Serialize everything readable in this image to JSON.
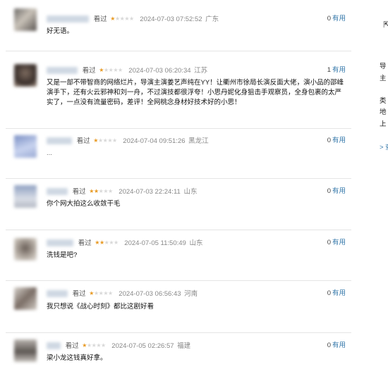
{
  "reviews": [
    {
      "watched": "看过",
      "stars": 1,
      "time": "2024-07-03 07:52:52",
      "loc": "广东",
      "useful_count": "0",
      "useful_label": "有用",
      "content": "好无语。"
    },
    {
      "watched": "看过",
      "stars": 1,
      "time": "2024-07-03 06:20:34",
      "loc": "江苏",
      "useful_count": "1",
      "useful_label": "有用",
      "content": "又是一部不带智商的网络烂片，导演主演姜艺声纯在YY！让衢州市徐局长演反面大佬，演小品的邵峰演手下，还有火云邪神和刘一舟，不过演技都很浮夸！小思丹妮化身狙击手观察员，全身包裹的太严实了，一点没有流量密码，差评！全网桃念身材好技术好的小思！"
    },
    {
      "watched": "看过",
      "stars": 1,
      "time": "2024-07-04 09:51:26",
      "loc": "黑龙江",
      "useful_count": "0",
      "useful_label": "有用",
      "content": "..."
    },
    {
      "watched": "看过",
      "stars": 2,
      "time": "2024-07-03 22:24:11",
      "loc": "山东",
      "useful_count": "0",
      "useful_label": "有用",
      "content": "你个网大拍这么收敛干毛"
    },
    {
      "watched": "看过",
      "stars": 2,
      "time": "2024-07-05 11:50:49",
      "loc": "山东",
      "useful_count": "0",
      "useful_label": "有用",
      "content": "洗钱是吧?"
    },
    {
      "watched": "看过",
      "stars": 1,
      "time": "2024-07-03 06:56:43",
      "loc": "河南",
      "useful_count": "0",
      "useful_label": "有用",
      "content": "我只想说《战心时刻》都比这剧好看"
    },
    {
      "watched": "看过",
      "stars": 1,
      "time": "2024-07-05 02:26:57",
      "loc": "福建",
      "useful_count": "0",
      "useful_label": "有用",
      "content": "梁小龙这钱真好拿。"
    }
  ],
  "sidebar": {
    "lines": [
      "导",
      "主",
      "类",
      "地",
      "上",
      "> 查"
    ]
  },
  "colors": {
    "star_on": "#e89a23",
    "star_off": "#d8d8d8",
    "link": "#3377aa",
    "divider": "#e5e5e5"
  }
}
